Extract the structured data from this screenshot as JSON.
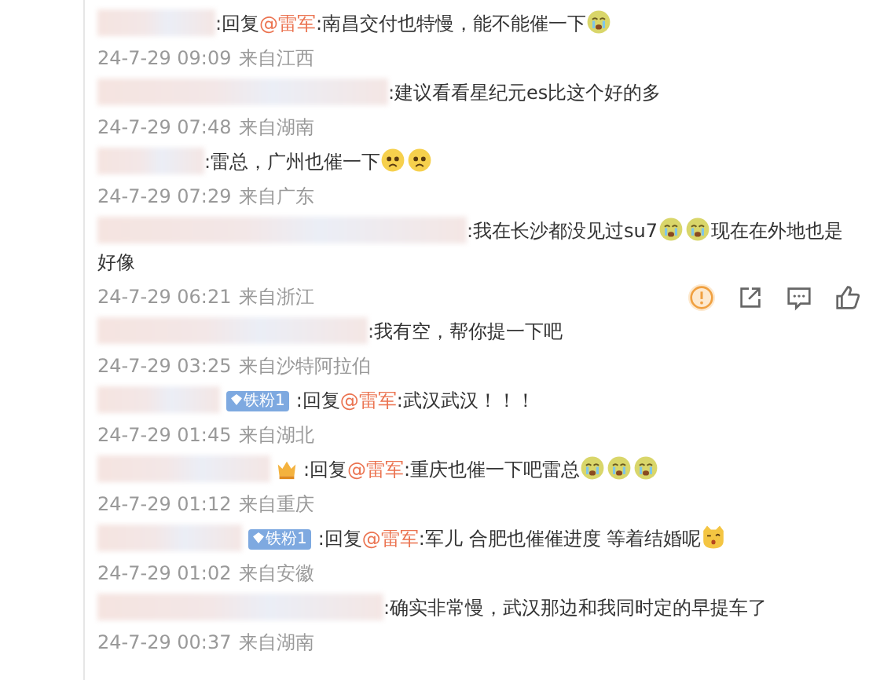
{
  "comments": [
    {
      "segments": [
        {
          "kind": "text",
          "text": ":回复"
        },
        {
          "kind": "mention",
          "text": "@雷军"
        },
        {
          "kind": "text",
          "text": ":南昌交付也特慢，能不能催一下"
        },
        {
          "kind": "cry_emoji"
        }
      ],
      "time": "24-7-29 09:09",
      "location": "来自江西",
      "hovered": false
    },
    {
      "segments": [
        {
          "kind": "text",
          "text": ":建议看看星纪元es比这个好的多"
        }
      ],
      "time": "24-7-29 07:48",
      "location": "来自湖南",
      "hovered": false
    },
    {
      "segments": [
        {
          "kind": "text",
          "text": ":雷总，广州也催一下"
        },
        {
          "kind": "sad_emoji"
        },
        {
          "kind": "sad_emoji"
        }
      ],
      "time": "24-7-29 07:29",
      "location": "来自广东",
      "hovered": false
    },
    {
      "segments": [
        {
          "kind": "text",
          "text": ":我在长沙都没见过su7"
        },
        {
          "kind": "cry_emoji"
        },
        {
          "kind": "cry_emoji"
        },
        {
          "kind": "text",
          "text": "现在在外地也是好像"
        }
      ],
      "time": "24-7-29 06:21",
      "location": "来自浙江",
      "hovered": true
    },
    {
      "segments": [
        {
          "kind": "text",
          "text": ":我有空，帮你提一下吧"
        }
      ],
      "time": "24-7-29 03:25",
      "location": "来自沙特阿拉伯",
      "hovered": false
    },
    {
      "badge": {
        "kind": "fan",
        "text": "铁粉1"
      },
      "segments": [
        {
          "kind": "text",
          "text": ":回复"
        },
        {
          "kind": "mention",
          "text": "@雷军"
        },
        {
          "kind": "text",
          "text": ":武汉武汉！！！"
        }
      ],
      "time": "24-7-29 01:45",
      "location": "来自湖北",
      "hovered": false
    },
    {
      "badge": {
        "kind": "crown"
      },
      "segments": [
        {
          "kind": "text",
          "text": ":回复"
        },
        {
          "kind": "mention",
          "text": "@雷军"
        },
        {
          "kind": "text",
          "text": ":重庆也催一下吧雷总"
        },
        {
          "kind": "cry_emoji"
        },
        {
          "kind": "cry_emoji"
        },
        {
          "kind": "cry_emoji"
        }
      ],
      "time": "24-7-29 01:12",
      "location": "来自重庆",
      "hovered": false
    },
    {
      "badge": {
        "kind": "fan",
        "text": "铁粉1"
      },
      "segments": [
        {
          "kind": "text",
          "text": ":回复"
        },
        {
          "kind": "mention",
          "text": "@雷军"
        },
        {
          "kind": "text",
          "text": ":军儿 合肥也催催进度 等着结婚呢"
        },
        {
          "kind": "cat_emoji"
        }
      ],
      "time": "24-7-29 01:02",
      "location": "来自安徽",
      "hovered": false
    },
    {
      "segments": [
        {
          "kind": "text",
          "text": ":确实非常慢，武汉那边和我同时定的早提车了"
        }
      ],
      "time": "24-7-29 00:37",
      "location": "来自湖南",
      "hovered": false
    }
  ]
}
